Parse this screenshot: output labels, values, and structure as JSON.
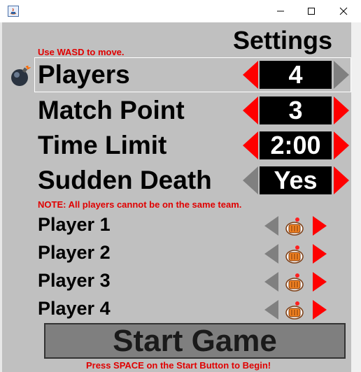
{
  "window": {
    "minimize_icon": "minimize-icon",
    "maximize_icon": "maximize-icon",
    "close_icon": "close-icon"
  },
  "header": {
    "title": "Settings"
  },
  "hints": {
    "controls": "Use WASD to move.",
    "note": "NOTE: All players cannot be on the same team.",
    "start": "Press SPACE on the Start Button to Begin!"
  },
  "settings": [
    {
      "label": "Players",
      "value": "4"
    },
    {
      "label": "Match Point",
      "value": "3"
    },
    {
      "label": "Time Limit",
      "value": "2:00"
    },
    {
      "label": "Sudden Death",
      "value": "Yes"
    }
  ],
  "players": [
    {
      "label": "Player 1"
    },
    {
      "label": "Player 2"
    },
    {
      "label": "Player 3"
    },
    {
      "label": "Player 4"
    }
  ],
  "start_button": {
    "label": "Start Game"
  },
  "colors": {
    "background": "#c0c0c0",
    "accent_red": "#ff0000",
    "hint_red": "#e00000",
    "box_black": "#000000",
    "disabled_arrow": "#808080"
  }
}
